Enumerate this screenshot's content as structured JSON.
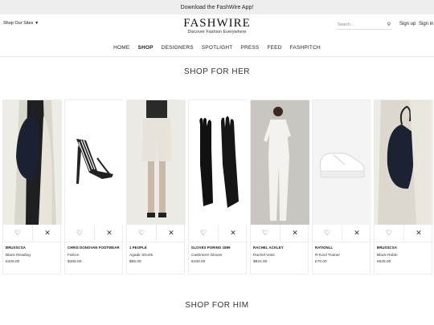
{
  "topbar": {
    "text": "Download the FashWire App!"
  },
  "header": {
    "shop_sites": "Shop Our Sites",
    "brand": "FASHWIRE",
    "tagline": "Discover Fashion Everywhere",
    "search_placeholder": "Search...",
    "sign_up": "Sign up",
    "sign_in": "Sign in"
  },
  "nav": [
    "HOME",
    "SHOP",
    "DESIGNERS",
    "SPOTLIGHT",
    "PRESS",
    "FEED",
    "FASHPITCH"
  ],
  "nav_active": "SHOP",
  "sections": {
    "her": "SHOP FOR HER",
    "him": "SHOP FOR HIM"
  },
  "products": [
    {
      "designer": "BRUSSCSA",
      "name": "Black Reading",
      "price": "€425.00",
      "image": "black-leather-bag-on-woman"
    },
    {
      "designer": "CHRIS DONOVAN FOOTWEAR",
      "name": "Falcon",
      "price": "$465.00",
      "image": "black-white-stiletto-sandal"
    },
    {
      "designer": "1 PEOPLE",
      "name": "Agadir Shorts",
      "price": "$95.00",
      "image": "white-shorts-on-model"
    },
    {
      "designer": "GLOVES PORINO 1899",
      "name": "Cashmere Gloves",
      "price": "€160.00",
      "image": "black-leather-gloves"
    },
    {
      "designer": "RACHEL ACKLEY",
      "name": "Rachel Voss",
      "price": "$822.00",
      "image": "white-suit-on-model"
    },
    {
      "designer": "RATIONLL",
      "name": "R-Kool Trainer",
      "price": "£70.00",
      "image": "white-platform-sneaker"
    },
    {
      "designer": "BRUSSCSA",
      "name": "Black Robin",
      "price": "€525.00",
      "image": "black-bucket-bag-on-woman"
    }
  ],
  "icons": {
    "like": "heart-icon",
    "dismiss": "close-icon",
    "search": "search-icon"
  }
}
